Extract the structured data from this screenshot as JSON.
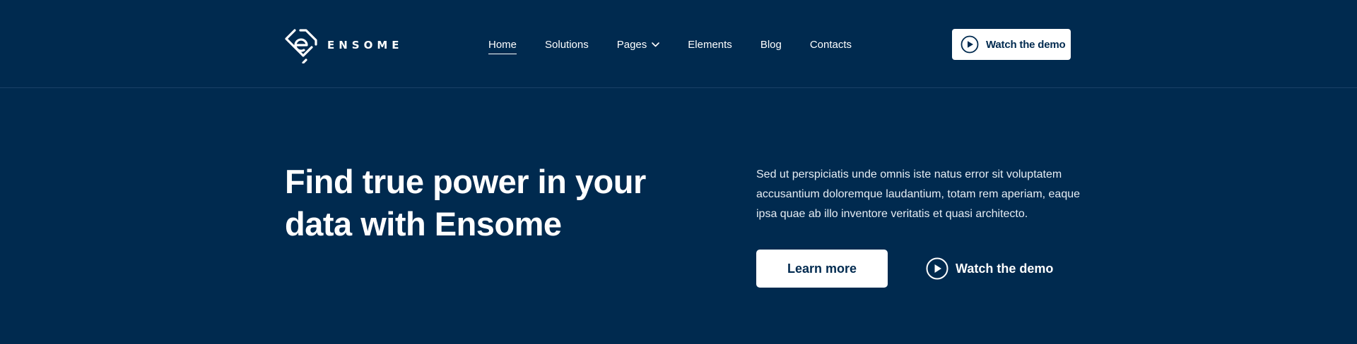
{
  "brand": {
    "name": "ENSOME",
    "logo_icon": "ensome-logo-icon"
  },
  "nav": {
    "items": [
      {
        "label": "Home",
        "active": true
      },
      {
        "label": "Solutions",
        "active": false
      },
      {
        "label": "Pages",
        "active": false,
        "has_dropdown": true
      },
      {
        "label": "Elements",
        "active": false
      },
      {
        "label": "Blog",
        "active": false
      },
      {
        "label": "Contacts",
        "active": false
      }
    ]
  },
  "header_cta": {
    "label": "Watch the demo",
    "icon": "play-icon"
  },
  "hero": {
    "title_line1": "Find true power in your",
    "title_line2": "data with Ensome",
    "description": "Sed ut perspiciatis unde omnis iste natus error sit voluptatem accusantium doloremque laudantium, totam rem aperiam, eaque ipsa quae ab illo inventore veritatis et quasi architecto.",
    "primary_button": "Learn more",
    "secondary_button": "Watch the demo"
  },
  "colors": {
    "background": "#002a4f",
    "button_bg": "#ffffff",
    "button_text": "#002a4f"
  }
}
